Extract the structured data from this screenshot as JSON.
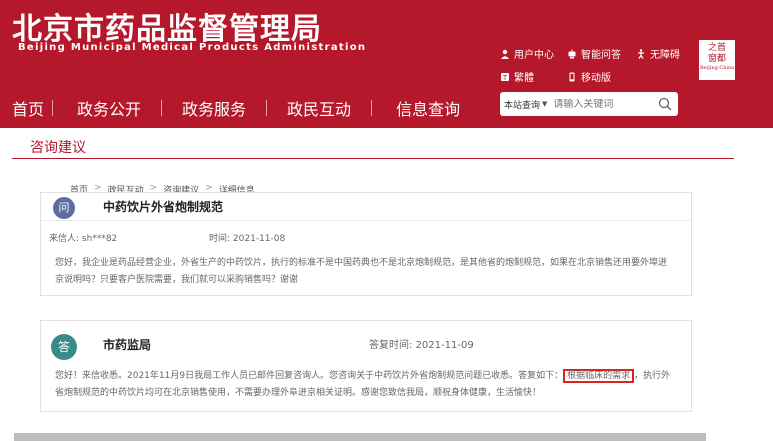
{
  "header": {
    "title_cn": "北京市药品监督管理局",
    "title_en": "Beijing Municipal Medical Products Administration",
    "utilities": {
      "user_center": "用户中心",
      "smart_qa": "智能问答",
      "accessibility": "无障碍",
      "traditional": "繁體",
      "mobile": "移动版"
    },
    "seal": {
      "line1": "之首",
      "line2": "窗都",
      "line3": "Beijing·China"
    }
  },
  "nav": [
    "首页",
    "政务公开",
    "政务服务",
    "政民互动",
    "信息查询"
  ],
  "search": {
    "scope": "本站查询",
    "placeholder": "请输入关键词"
  },
  "section_title": "咨询建议",
  "breadcrumb": [
    "首页",
    "政民互动",
    "咨询建议",
    "详细信息"
  ],
  "question": {
    "badge": "问",
    "title": "中药饮片外省炮制规范",
    "sender_label": "来信人:",
    "sender": "sh***82",
    "time_label": "时间:",
    "time": "2021-11-08",
    "body_line1": "您好，我企业是药品经营企业，外省生产的中药饮片，执行的标准不是中国药典也不是北京炮制规范，是其他省的炮制规范，如果在北京销售还用要外埠进",
    "body_line2": "京说明吗？只要客户医院需要，我们就可以采购销售吗？谢谢"
  },
  "answer": {
    "badge": "答",
    "title": "市药监局",
    "time_label": "答复时间:",
    "time": "2021-11-09",
    "body_pre": "您好！来信收悉。2021年11月9日我局工作人员已邮件回复咨询人。您咨询关于中药饮片外省炮制规范问题已收悉。答复如下：",
    "body_highlight": "根据临床的需求",
    "body_post": "，执行外",
    "body_line2": "省炮制规范的中药饮片均可在北京销售使用，不需要办理外阜进京相关证明。感谢您致信我局，顺祝身体健康，生活愉快！"
  },
  "colors": {
    "brand_red": "#b4182a",
    "highlight_border": "#dd2222"
  }
}
